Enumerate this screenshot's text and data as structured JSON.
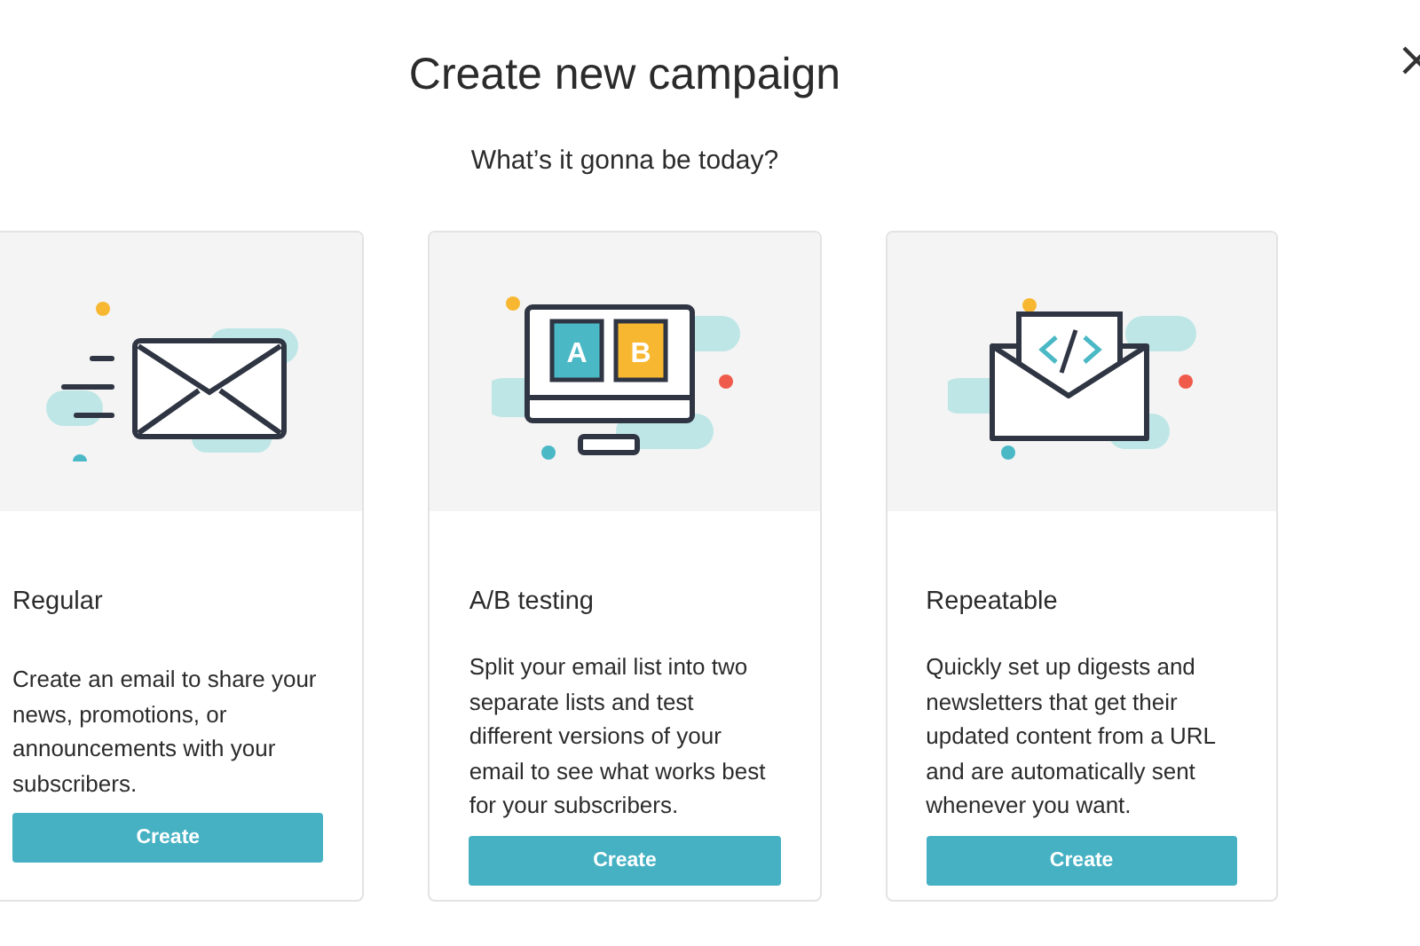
{
  "title": "Create new campaign",
  "subtitle": "What’s it gonna be today?",
  "cards": [
    {
      "kind": "regular",
      "name": "Regular",
      "description": "Create an email to share your news, promotions, or announcements with your subscribers.",
      "button": "Create"
    },
    {
      "kind": "ab",
      "name": "A/B testing",
      "description": "Split your email list into two separate lists and test different versions of your email to see what works best for your subscribers.",
      "button": "Create",
      "variants": [
        "A",
        "B"
      ]
    },
    {
      "kind": "repeatable",
      "name": "Repeatable",
      "description": "Quickly set up digests and newsletters that get their updated content from a URL and are automatically sent whenever you want.",
      "button": "Create"
    }
  ]
}
